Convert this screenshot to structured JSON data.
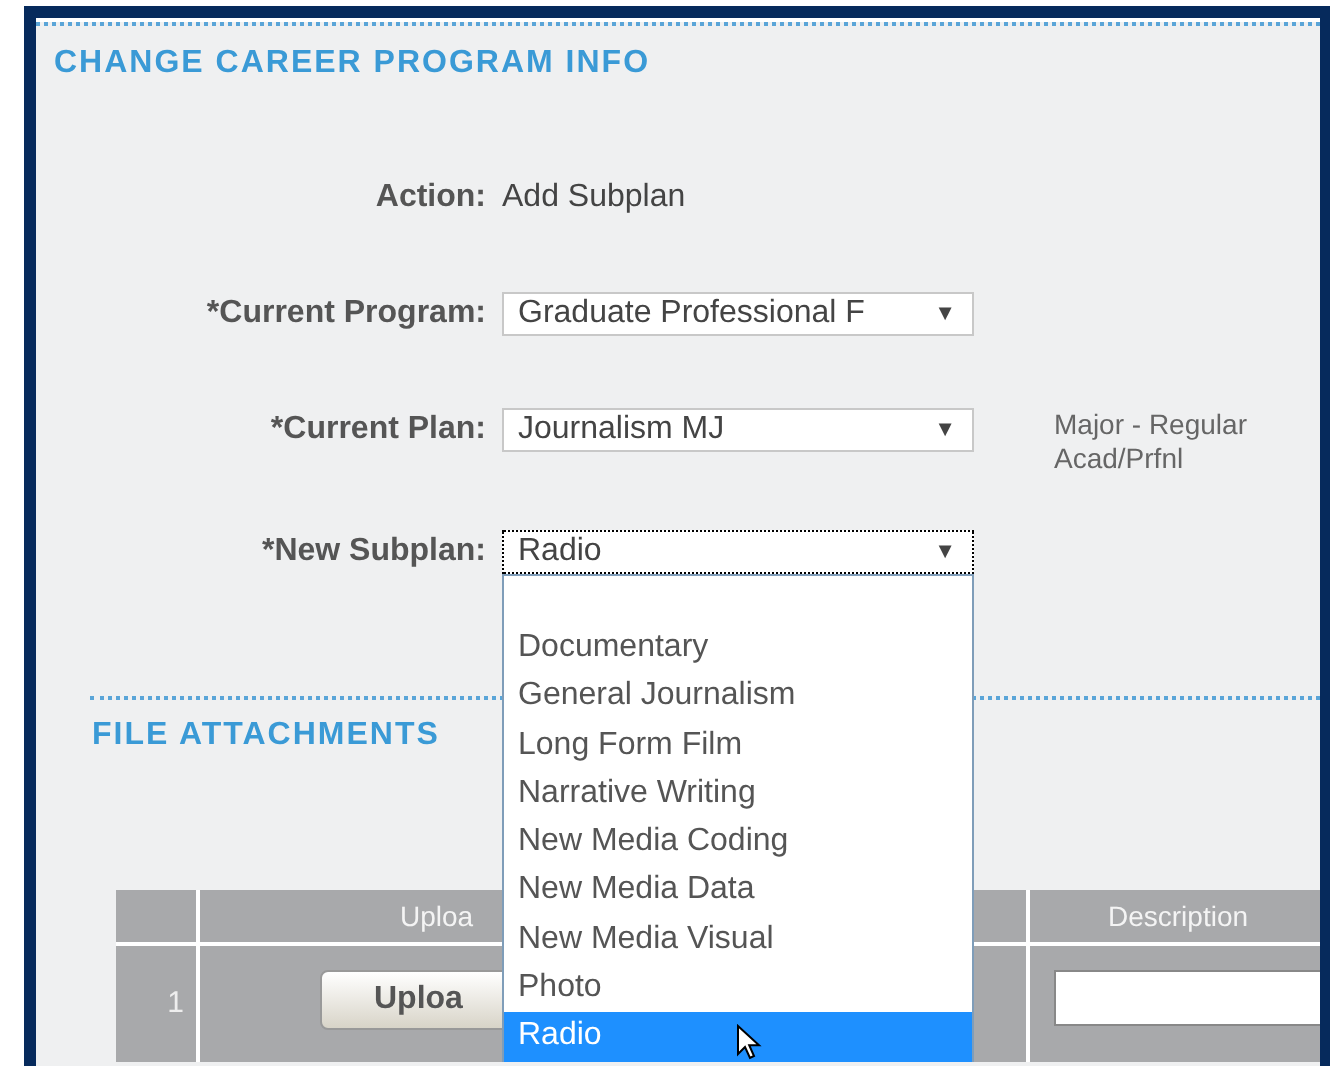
{
  "section_title": "CHANGE CAREER PROGRAM INFO",
  "fields": [
    {
      "kind": "text",
      "label": "Action:",
      "value": "Add Subplan"
    },
    {
      "kind": "select",
      "label": "*Current Program:",
      "value": "Graduate Professional F",
      "arrow": "▼"
    },
    {
      "kind": "select",
      "label": "*Current Plan:",
      "value": "Journalism MJ",
      "arrow": "▼",
      "note": "Major - Regular Acad/Prfnl"
    },
    {
      "kind": "select",
      "label": "*New Subplan:",
      "value": "Radio",
      "arrow": "▼",
      "expanded": true,
      "focused": true,
      "options": [
        {
          "label": "Documentary",
          "selected": false
        },
        {
          "label": "General Journalism",
          "selected": false
        },
        {
          "label": "Long Form Film",
          "selected": false
        },
        {
          "label": "Narrative Writing",
          "selected": false
        },
        {
          "label": "New Media Coding",
          "selected": false
        },
        {
          "label": "New Media Data",
          "selected": false
        },
        {
          "label": "New Media Visual",
          "selected": false
        },
        {
          "label": "Photo",
          "selected": false
        },
        {
          "label": "Radio",
          "selected": true
        }
      ]
    }
  ],
  "attachments": {
    "title": "FILE ATTACHMENTS",
    "columns": [
      "Uploa",
      "Description"
    ],
    "rows": [
      {
        "number": "1",
        "button": "Uploa"
      }
    ]
  }
}
